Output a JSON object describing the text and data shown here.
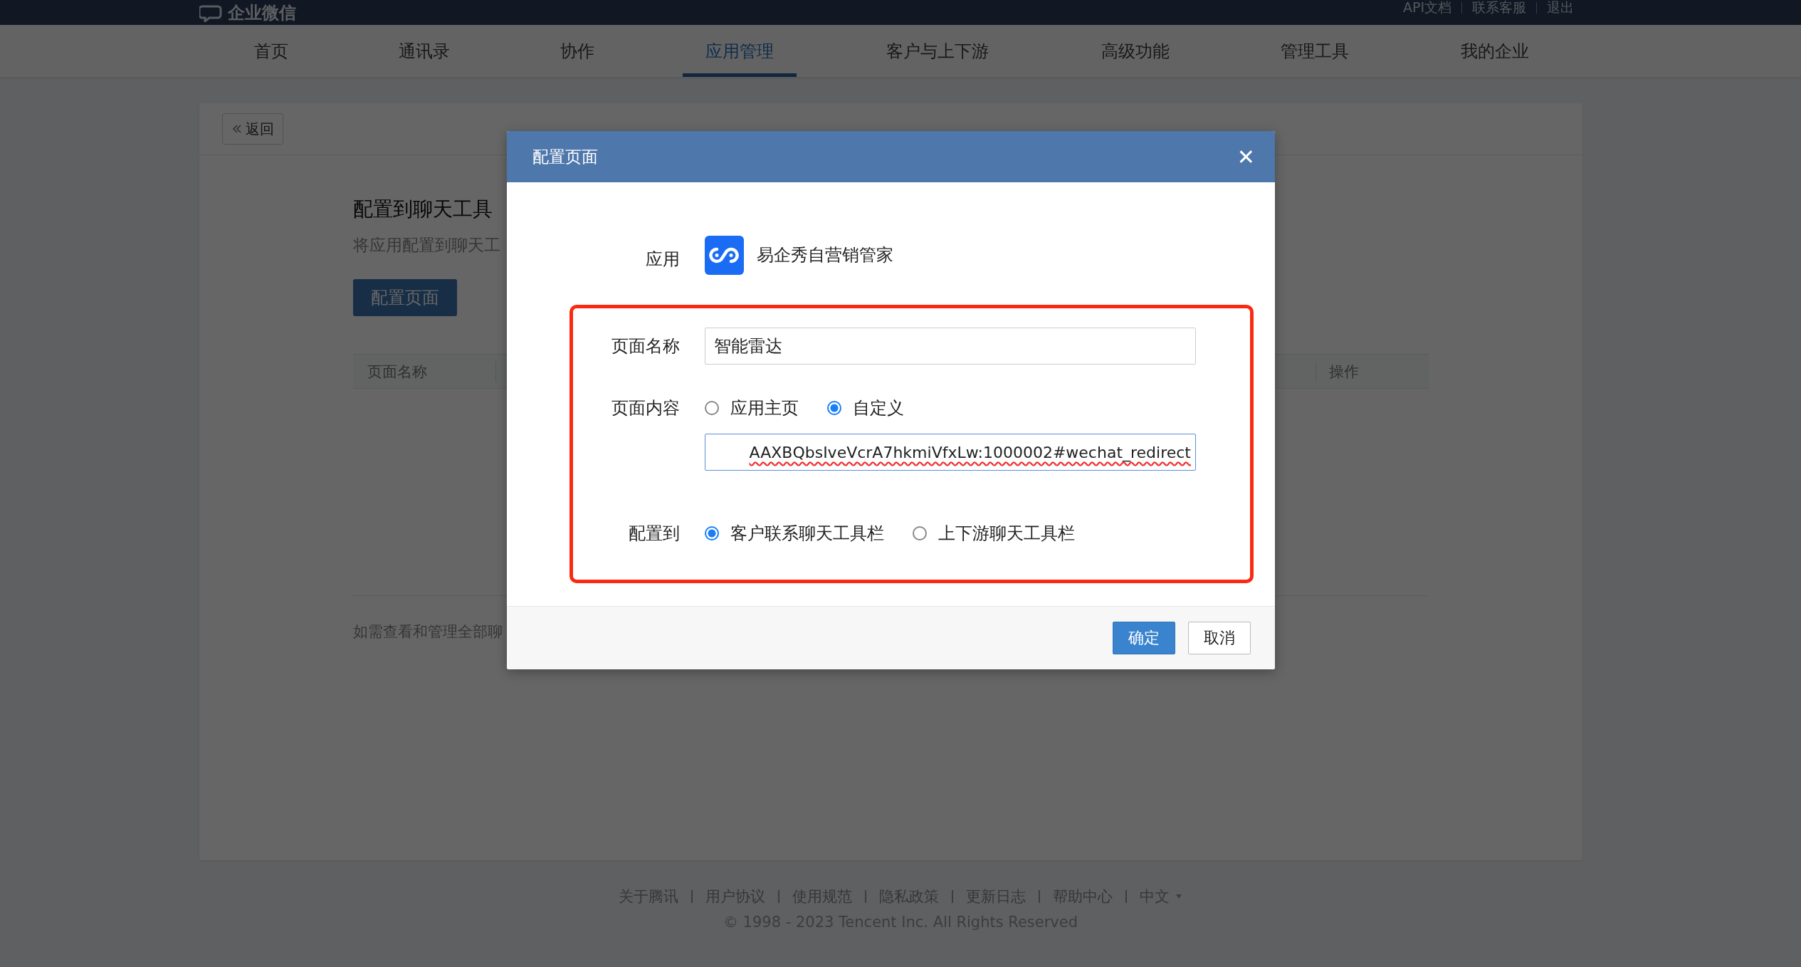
{
  "header": {
    "logo": "企业微信",
    "links": [
      "API文档",
      "联系客服",
      "退出"
    ]
  },
  "nav": [
    {
      "label": "首页",
      "selected": false
    },
    {
      "label": "通讯录",
      "selected": false
    },
    {
      "label": "协作",
      "selected": false
    },
    {
      "label": "应用管理",
      "selected": true
    },
    {
      "label": "客户与上下游",
      "selected": false
    },
    {
      "label": "高级功能",
      "selected": false
    },
    {
      "label": "管理工具",
      "selected": false
    },
    {
      "label": "我的企业",
      "selected": false
    }
  ],
  "page": {
    "back": "返回",
    "heading": "配置到聊天工具",
    "description": "将应用配置到聊天工",
    "button": "配置页面",
    "columns": [
      "页面名称",
      "操作"
    ],
    "note": "如需查看和管理全部聊"
  },
  "dialog": {
    "title": "配置页面",
    "close": "✕",
    "app": {
      "label": "应用",
      "name": "易企秀自营销管家"
    },
    "page_name": {
      "label": "页面名称",
      "value": "智能雷达"
    },
    "page_content": {
      "label": "页面内容",
      "options": [
        {
          "label": "应用主页",
          "selected": false
        },
        {
          "label": "自定义",
          "selected": true
        }
      ],
      "url": "AAXBQbsIveVcrA7hkmiVfxLw:1000002#wechat_redirect"
    },
    "target": {
      "label": "配置到",
      "options": [
        {
          "label": "客户联系聊天工具栏",
          "selected": true
        },
        {
          "label": "上下游聊天工具栏",
          "selected": false
        }
      ]
    },
    "buttons": [
      {
        "label": "确定",
        "kind": "primary"
      },
      {
        "label": "取消",
        "kind": "default"
      }
    ]
  },
  "footer": {
    "links": [
      "关于腾讯",
      "用户协议",
      "使用规范",
      "隐私政策",
      "更新日志",
      "帮助中心"
    ],
    "language": "中文",
    "copyright": "© 1998 - 2023 Tencent Inc. All Rights Reserved"
  }
}
